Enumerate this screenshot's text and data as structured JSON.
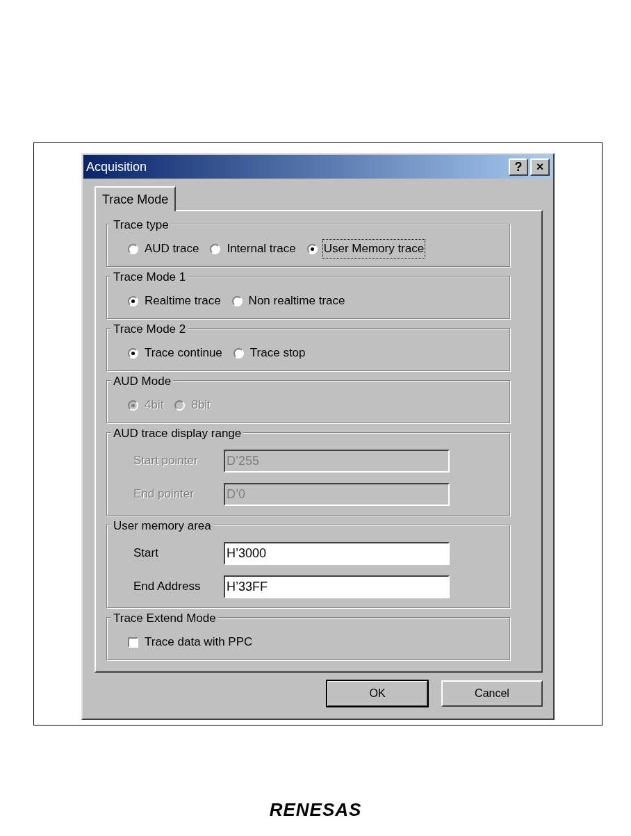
{
  "window": {
    "title": "Acquisition"
  },
  "title_buttons": [
    "?",
    "×"
  ],
  "tabs": [
    {
      "label": "Trace Mode",
      "selected": true
    }
  ],
  "groups": [
    {
      "kind": "radios",
      "title": "Trace type",
      "disabled": false,
      "options": [
        {
          "label": "AUD trace",
          "selected": false,
          "focused": false
        },
        {
          "label": "Internal trace",
          "selected": false,
          "focused": false
        },
        {
          "label": "User Memory trace",
          "selected": true,
          "focused": true
        }
      ]
    },
    {
      "kind": "radios",
      "title": "Trace Mode 1",
      "disabled": false,
      "options": [
        {
          "label": "Realtime trace",
          "selected": true,
          "focused": false
        },
        {
          "label": "Non realtime trace",
          "selected": false,
          "focused": false
        }
      ]
    },
    {
      "kind": "radios",
      "title": "Trace Mode 2",
      "disabled": false,
      "options": [
        {
          "label": "Trace continue",
          "selected": true,
          "focused": false
        },
        {
          "label": "Trace stop",
          "selected": false,
          "focused": false
        }
      ]
    },
    {
      "kind": "radios",
      "title": "AUD Mode",
      "disabled": true,
      "options": [
        {
          "label": "4bit",
          "selected": true,
          "focused": false
        },
        {
          "label": "8bit",
          "selected": false,
          "focused": false
        }
      ]
    },
    {
      "kind": "fields",
      "title": "AUD trace display range",
      "disabled": true,
      "fields": [
        {
          "label": "Start pointer",
          "value": "D’255"
        },
        {
          "label": "End pointer",
          "value": "D’0"
        }
      ]
    },
    {
      "kind": "fields",
      "title": "User memory area",
      "disabled": false,
      "fields": [
        {
          "label": "Start",
          "value": "H’3000"
        },
        {
          "label": "End Address",
          "value": "H’33FF"
        }
      ]
    },
    {
      "kind": "checks",
      "title": "Trace Extend Mode",
      "disabled": false,
      "options": [
        {
          "label": "Trace data with PPC",
          "checked": false
        }
      ]
    }
  ],
  "buttons": [
    {
      "label": "OK",
      "default": true
    },
    {
      "label": "Cancel",
      "default": false
    }
  ],
  "footer": {
    "logo": "RENESAS"
  }
}
